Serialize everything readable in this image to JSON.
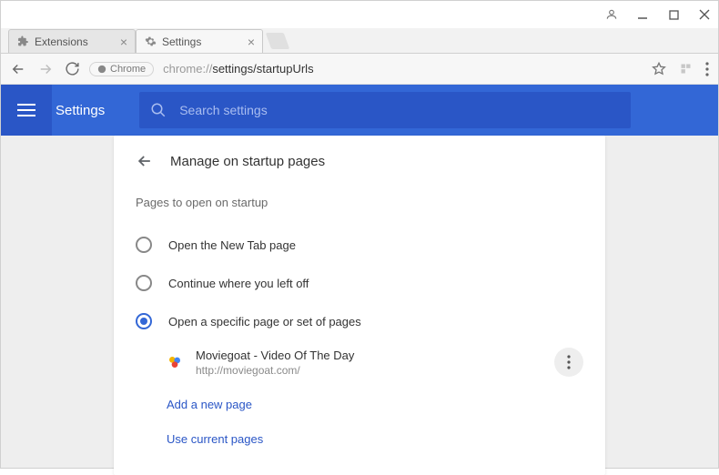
{
  "window": {
    "tabs": [
      {
        "label": "Extensions"
      },
      {
        "label": "Settings"
      }
    ]
  },
  "address": {
    "scheme_label": "Chrome",
    "host": "chrome://",
    "path": "settings/startupUrls"
  },
  "bluebar": {
    "title": "Settings",
    "search_placeholder": "Search settings"
  },
  "card": {
    "title": "Manage on startup pages",
    "section_label": "Pages to open on startup",
    "options": [
      {
        "label": "Open the New Tab page"
      },
      {
        "label": "Continue where you left off"
      },
      {
        "label": "Open a specific page or set of pages"
      }
    ],
    "entry": {
      "title": "Moviegoat - Video Of The Day",
      "url": "http://moviegoat.com/"
    },
    "link_add": "Add a new page",
    "link_use": "Use current pages"
  }
}
